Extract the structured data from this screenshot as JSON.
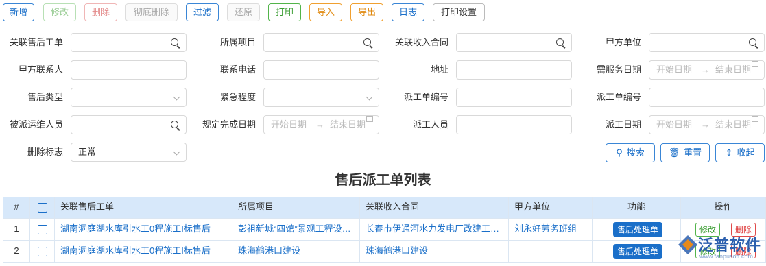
{
  "toolbar": {
    "add": "新增",
    "edit": "修改",
    "delete": "删除",
    "purge": "彻底删除",
    "filter": "过滤",
    "restore": "还原",
    "print": "打印",
    "import": "导入",
    "export": "导出",
    "log": "日志",
    "print_settings": "打印设置"
  },
  "form": {
    "related_ticket": "关联售后工单",
    "project": "所属项目",
    "income_contract": "关联收入合同",
    "party_a": "甲方单位",
    "party_a_contact": "甲方联系人",
    "phone": "联系电话",
    "address": "地址",
    "service_date": "需服务日期",
    "service_type": "售后类型",
    "urgency": "紧急程度",
    "dispatch_no_1": "派工单编号",
    "dispatch_no_2": "派工单编号",
    "assignee": "被派运维人员",
    "planned_finish": "规定完成日期",
    "dispatcher": "派工人员",
    "dispatch_date": "派工日期",
    "delete_flag": "删除标志",
    "delete_flag_value": "正常",
    "start_placeholder": "开始日期",
    "end_placeholder": "结束日期",
    "range_arrow": "→"
  },
  "actions": {
    "search": "搜索",
    "reset": "重置",
    "collapse": "收起"
  },
  "list_title": "售后派工单列表",
  "table": {
    "headers": {
      "index": "#",
      "ticket": "关联售后工单",
      "project": "所属项目",
      "contract": "关联收入合同",
      "party_a": "甲方单位",
      "function": "功能",
      "operation": "操作"
    },
    "rows": [
      {
        "index": "1",
        "ticket": "湖南洞庭湖水库引水工0程施工I标售后",
        "project": "彭祖新城“四馆”景观工程设计施工",
        "contract": "长春市伊通河水力发电厂改建工程合同",
        "party_a": "刘永好劳务班组",
        "func": "售后处理单",
        "edit": "修改",
        "del": "删除"
      },
      {
        "index": "2",
        "ticket": "湖南洞庭湖水库引水工0程施工I标售后",
        "project": "珠海鹤港口建设",
        "contract": "珠海鹤港口建设",
        "party_a": "",
        "func": "售后处理单",
        "edit": "修改",
        "del": "删除"
      }
    ]
  },
  "logo": {
    "text": "泛普软件",
    "url": "www.fanpusoft.com"
  },
  "colors": {
    "primary": "#1a6fc9",
    "header_bg": "#d7e8fa",
    "green": "#3d9e35",
    "red": "#d33",
    "orange": "#e08a10"
  }
}
